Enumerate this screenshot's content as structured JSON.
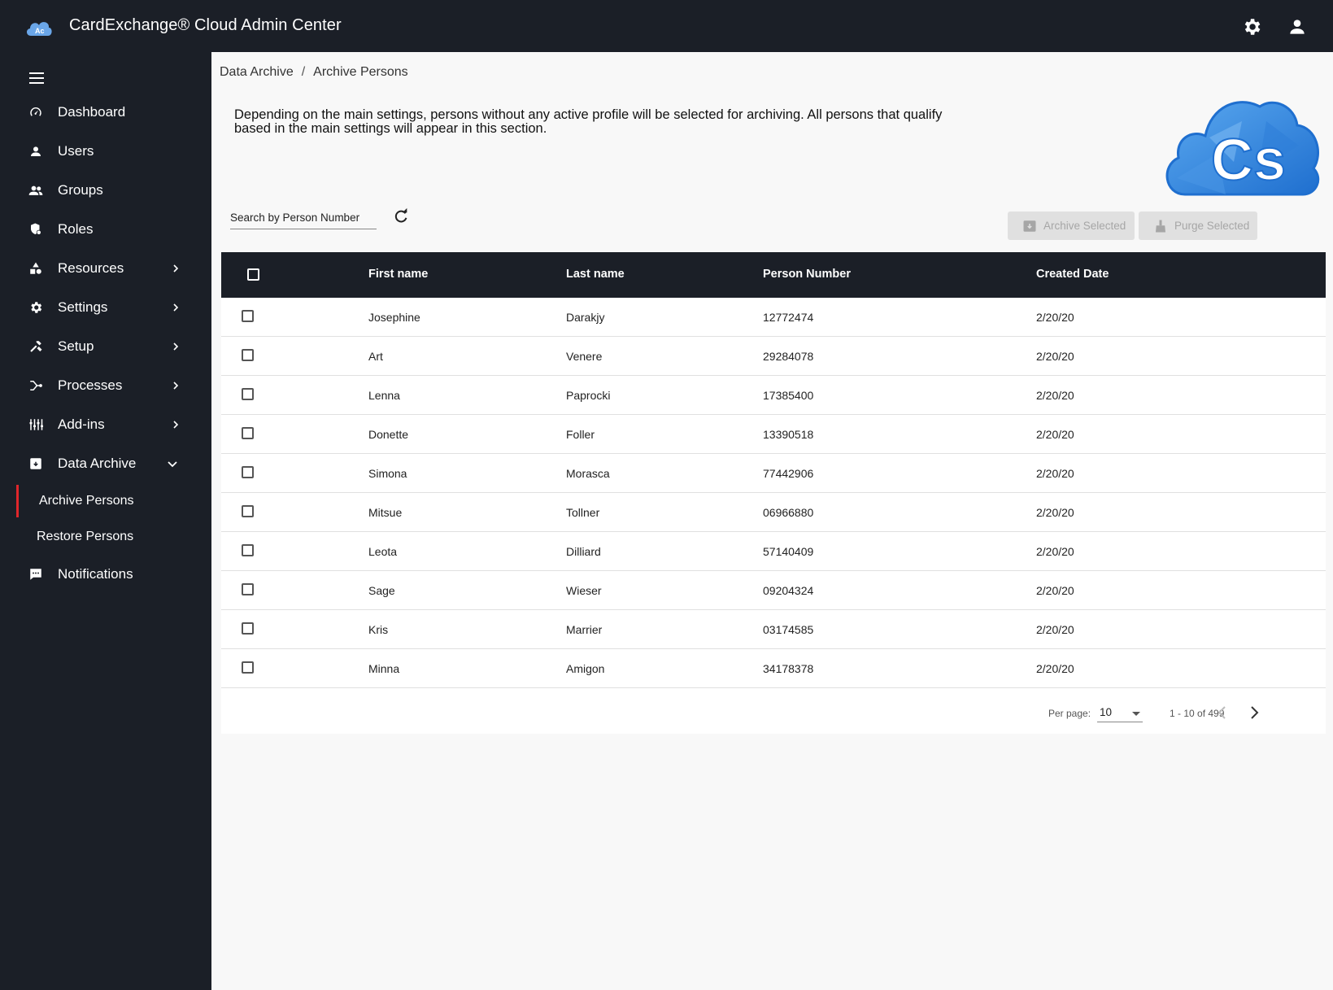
{
  "app": {
    "title": "CardExchange® Cloud Admin Center"
  },
  "icons": {
    "logo": "cloud-ac-logo",
    "settings": "gear-icon",
    "account": "person-icon",
    "menu": "hamburger-icon"
  },
  "sidebar": {
    "items": [
      {
        "label": "Dashboard",
        "icon": "dashboard-icon"
      },
      {
        "label": "Users",
        "icon": "user-icon"
      },
      {
        "label": "Groups",
        "icon": "group-icon"
      },
      {
        "label": "Roles",
        "icon": "roles-icon"
      },
      {
        "label": "Resources",
        "icon": "resources-icon"
      },
      {
        "label": "Settings",
        "icon": "settings-icon"
      },
      {
        "label": "Setup",
        "icon": "tools-icon"
      },
      {
        "label": "Processes",
        "icon": "process-icon"
      },
      {
        "label": "Add-ins",
        "icon": "addins-icon"
      },
      {
        "label": "Data Archive",
        "icon": "archive-icon"
      },
      {
        "label": "Notifications",
        "icon": "notification-icon"
      }
    ],
    "sub_items": [
      {
        "label": "Archive Persons",
        "active": true
      },
      {
        "label": "Restore Persons",
        "active": false
      }
    ]
  },
  "breadcrumb": {
    "parent": "Data Archive",
    "separator": "/",
    "current": "Archive Persons"
  },
  "intro": "Depending on the main settings, persons without any active profile will be selected for archiving. All persons that qualify based in the main settings will appear in this section.",
  "search": {
    "placeholder": "Search by Person Number",
    "value": ""
  },
  "actions": {
    "archive_label": "Archive Selected",
    "purge_label": "Purge Selected"
  },
  "table": {
    "headers": [
      "First name",
      "Last name",
      "Person Number",
      "Created Date"
    ],
    "rows": [
      {
        "first": "Josephine",
        "last": "Darakjy",
        "number": "12772474",
        "created": "2/20/20"
      },
      {
        "first": "Art",
        "last": "Venere",
        "number": "29284078",
        "created": "2/20/20"
      },
      {
        "first": "Lenna",
        "last": "Paprocki",
        "number": "17385400",
        "created": "2/20/20"
      },
      {
        "first": "Donette",
        "last": "Foller",
        "number": "13390518",
        "created": "2/20/20"
      },
      {
        "first": "Simona",
        "last": "Morasca",
        "number": "77442906",
        "created": "2/20/20"
      },
      {
        "first": "Mitsue",
        "last": "Tollner",
        "number": "06966880",
        "created": "2/20/20"
      },
      {
        "first": "Leota",
        "last": "Dilliard",
        "number": "57140409",
        "created": "2/20/20"
      },
      {
        "first": "Sage",
        "last": "Wieser",
        "number": "09204324",
        "created": "2/20/20"
      },
      {
        "first": "Kris",
        "last": "Marrier",
        "number": "03174585",
        "created": "2/20/20"
      },
      {
        "first": "Minna",
        "last": "Amigon",
        "number": "34178378",
        "created": "2/20/20"
      }
    ]
  },
  "pagination": {
    "per_page_label": "Per page:",
    "per_page": "10",
    "range": "1 - 10 of 499"
  },
  "colors": {
    "topbar": "#1b1f27",
    "sidebar": "#1b1f27",
    "active_marker": "#e0262b",
    "logo_blue": "#2f86de"
  }
}
